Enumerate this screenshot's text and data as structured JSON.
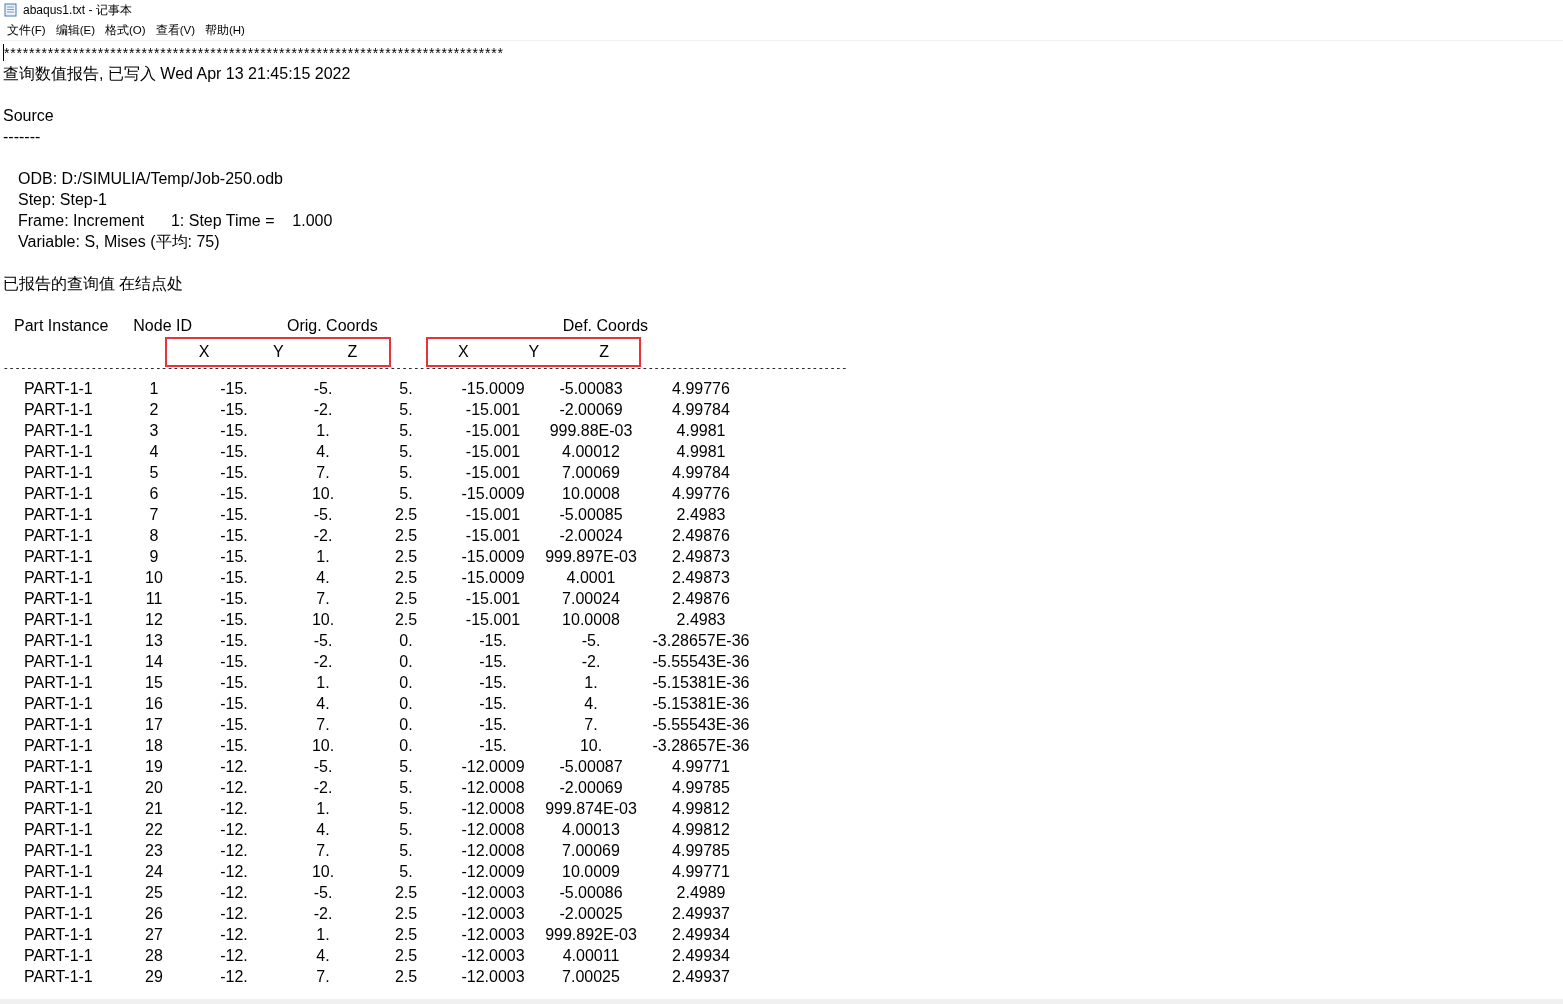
{
  "window": {
    "title": "abaqus1.txt - 记事本"
  },
  "menu": [
    "文件(F)",
    "编辑(E)",
    "格式(O)",
    "查看(V)",
    "帮助(H)"
  ],
  "document": {
    "stars": "********************************************************************************",
    "report_line": "查询数值报告, 已写入 Wed Apr 13 21:45:15 2022",
    "source_heading": "Source",
    "source_rule": "-------",
    "source_lines": [
      "ODB: D:/SIMULIA/Temp/Job-250.odb",
      "Step: Step-1",
      "Frame: Increment      1: Step Time =    1.000",
      "Variable: S, Mises (平均: 75)"
    ],
    "values_heading": "已报告的查询值 在结点处",
    "table": {
      "headers": [
        "Part Instance",
        "Node ID",
        "Orig. Coords",
        "Def. Coords"
      ],
      "orig_axes": [
        "X",
        "Y",
        "Z"
      ],
      "def_axes": [
        "X",
        "Y",
        "Z"
      ],
      "rule": "------------------------------------------------------------------------------------------------------------------------------------------------",
      "rows": [
        [
          "PART-1-1",
          "1",
          "-15.",
          "-5.",
          "5.",
          "-15.0009",
          "-5.00083",
          "4.99776"
        ],
        [
          "PART-1-1",
          "2",
          "-15.",
          "-2.",
          "5.",
          "-15.001",
          "-2.00069",
          "4.99784"
        ],
        [
          "PART-1-1",
          "3",
          "-15.",
          "1.",
          "5.",
          "-15.001",
          "999.88E-03",
          "4.9981"
        ],
        [
          "PART-1-1",
          "4",
          "-15.",
          "4.",
          "5.",
          "-15.001",
          "4.00012",
          "4.9981"
        ],
        [
          "PART-1-1",
          "5",
          "-15.",
          "7.",
          "5.",
          "-15.001",
          "7.00069",
          "4.99784"
        ],
        [
          "PART-1-1",
          "6",
          "-15.",
          "10.",
          "5.",
          "-15.0009",
          "10.0008",
          "4.99776"
        ],
        [
          "PART-1-1",
          "7",
          "-15.",
          "-5.",
          "2.5",
          "-15.001",
          "-5.00085",
          "2.4983"
        ],
        [
          "PART-1-1",
          "8",
          "-15.",
          "-2.",
          "2.5",
          "-15.001",
          "-2.00024",
          "2.49876"
        ],
        [
          "PART-1-1",
          "9",
          "-15.",
          "1.",
          "2.5",
          "-15.0009",
          "999.897E-03",
          "2.49873"
        ],
        [
          "PART-1-1",
          "10",
          "-15.",
          "4.",
          "2.5",
          "-15.0009",
          "4.0001",
          "2.49873"
        ],
        [
          "PART-1-1",
          "11",
          "-15.",
          "7.",
          "2.5",
          "-15.001",
          "7.00024",
          "2.49876"
        ],
        [
          "PART-1-1",
          "12",
          "-15.",
          "10.",
          "2.5",
          "-15.001",
          "10.0008",
          "2.4983"
        ],
        [
          "PART-1-1",
          "13",
          "-15.",
          "-5.",
          "0.",
          "-15.",
          "-5.",
          "-3.28657E-36"
        ],
        [
          "PART-1-1",
          "14",
          "-15.",
          "-2.",
          "0.",
          "-15.",
          "-2.",
          "-5.55543E-36"
        ],
        [
          "PART-1-1",
          "15",
          "-15.",
          "1.",
          "0.",
          "-15.",
          "1.",
          "-5.15381E-36"
        ],
        [
          "PART-1-1",
          "16",
          "-15.",
          "4.",
          "0.",
          "-15.",
          "4.",
          "-5.15381E-36"
        ],
        [
          "PART-1-1",
          "17",
          "-15.",
          "7.",
          "0.",
          "-15.",
          "7.",
          "-5.55543E-36"
        ],
        [
          "PART-1-1",
          "18",
          "-15.",
          "10.",
          "0.",
          "-15.",
          "10.",
          "-3.28657E-36"
        ],
        [
          "PART-1-1",
          "19",
          "-12.",
          "-5.",
          "5.",
          "-12.0009",
          "-5.00087",
          "4.99771"
        ],
        [
          "PART-1-1",
          "20",
          "-12.",
          "-2.",
          "5.",
          "-12.0008",
          "-2.00069",
          "4.99785"
        ],
        [
          "PART-1-1",
          "21",
          "-12.",
          "1.",
          "5.",
          "-12.0008",
          "999.874E-03",
          "4.99812"
        ],
        [
          "PART-1-1",
          "22",
          "-12.",
          "4.",
          "5.",
          "-12.0008",
          "4.00013",
          "4.99812"
        ],
        [
          "PART-1-1",
          "23",
          "-12.",
          "7.",
          "5.",
          "-12.0008",
          "7.00069",
          "4.99785"
        ],
        [
          "PART-1-1",
          "24",
          "-12.",
          "10.",
          "5.",
          "-12.0009",
          "10.0009",
          "4.99771"
        ],
        [
          "PART-1-1",
          "25",
          "-12.",
          "-5.",
          "2.5",
          "-12.0003",
          "-5.00086",
          "2.4989"
        ],
        [
          "PART-1-1",
          "26",
          "-12.",
          "-2.",
          "2.5",
          "-12.0003",
          "-2.00025",
          "2.49937"
        ],
        [
          "PART-1-1",
          "27",
          "-12.",
          "1.",
          "2.5",
          "-12.0003",
          "999.892E-03",
          "2.49934"
        ],
        [
          "PART-1-1",
          "28",
          "-12.",
          "4.",
          "2.5",
          "-12.0003",
          "4.00011",
          "2.49934"
        ],
        [
          "PART-1-1",
          "29",
          "-12.",
          "7.",
          "2.5",
          "-12.0003",
          "7.00025",
          "2.49937"
        ]
      ]
    }
  }
}
